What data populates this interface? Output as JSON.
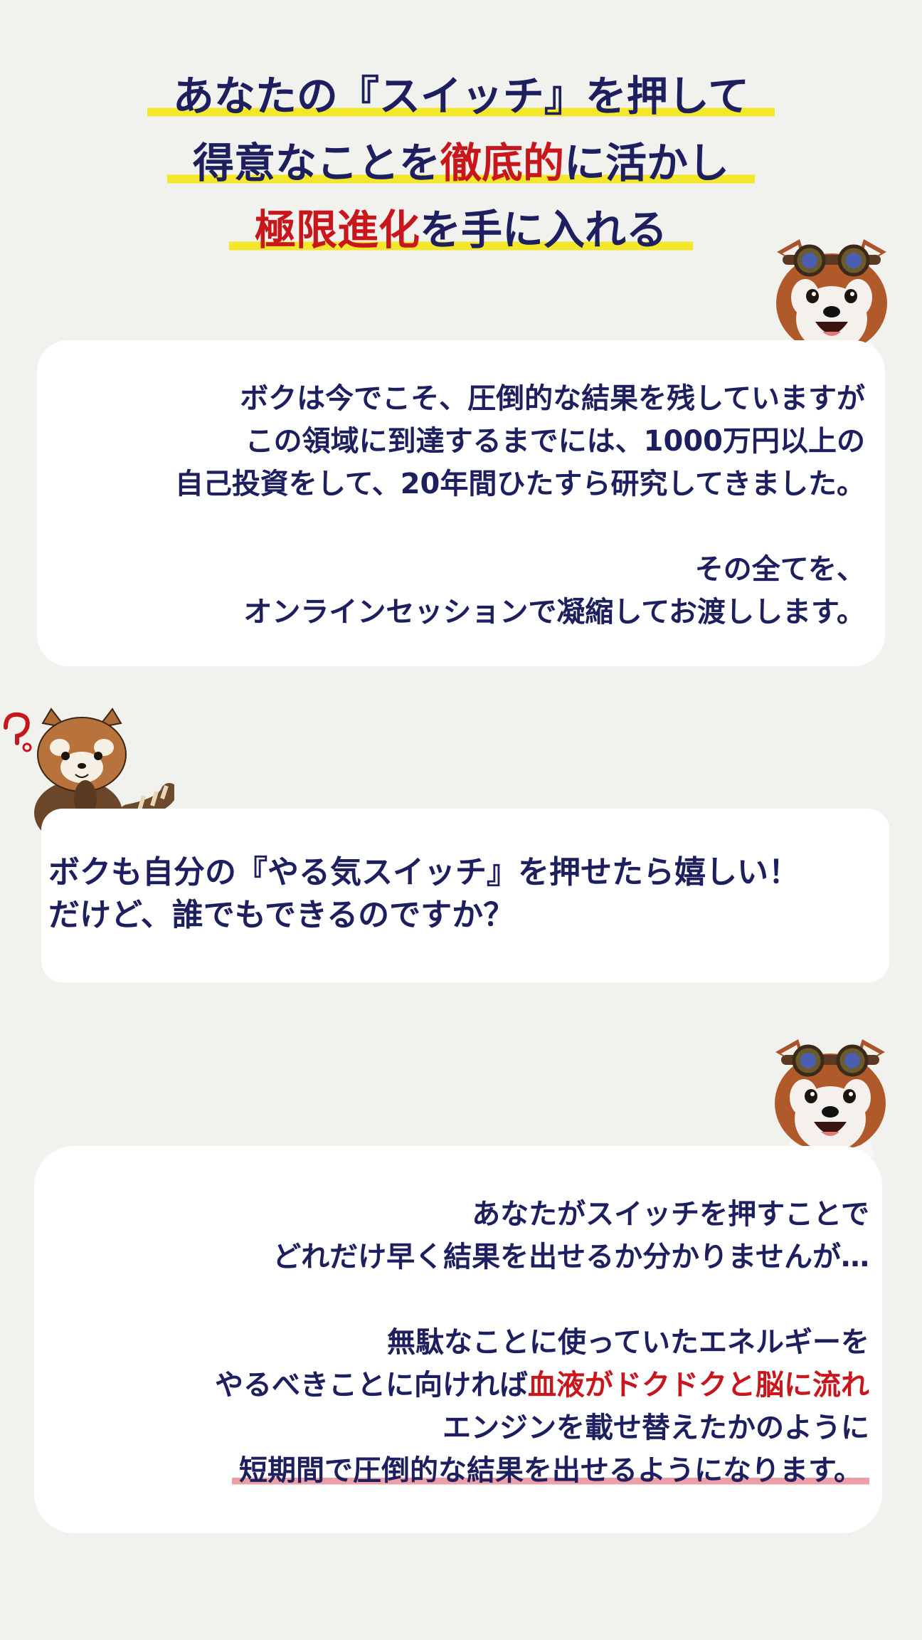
{
  "headline": {
    "line1": "あなたの『スイッチ』を押して",
    "line2_a": "得意なことを",
    "line2_red": "徹底的",
    "line2_b": "に活かし",
    "line3_red": "極限進化",
    "line3_b": "を手に入れる"
  },
  "bubble1": {
    "lines": [
      "ボクは今でこそ、圧倒的な結果を残していますが",
      "この領域に到達するまでには、1000万円以上の",
      "自己投資をして、20年間ひたすら研究してきました。"
    ],
    "lines2": [
      "その全てを、",
      "オンラインセッションで凝縮してお渡しします。"
    ]
  },
  "bubble2": {
    "lines": [
      "ボクも自分の『やる気スイッチ』を押せたら嬉しい！",
      "だけど、誰でもできるのですか？"
    ]
  },
  "bubble3": {
    "line1": "あなたがスイッチを押すことで",
    "line2": "どれだけ早く結果を出せるか分かりませんが…",
    "line3": "無駄なことに使っていたエネルギーを",
    "line4_a": "やるべきことに向ければ",
    "line4_red": "血液がドクドクと脳に流れ",
    "line5": "エンジンを載せ替えたかのように",
    "line6": "短期間で圧倒的な結果を出せるようになります。"
  },
  "colors": {
    "background": "#f1f1ee",
    "navy_text": "#1d1f5e",
    "red_accent": "#c8171c",
    "yellow_marker": "#f2e72b",
    "pink_marker": "#eba0a7"
  },
  "icons": [
    "red-panda-goggles-mascot",
    "red-panda-question-mascot"
  ]
}
